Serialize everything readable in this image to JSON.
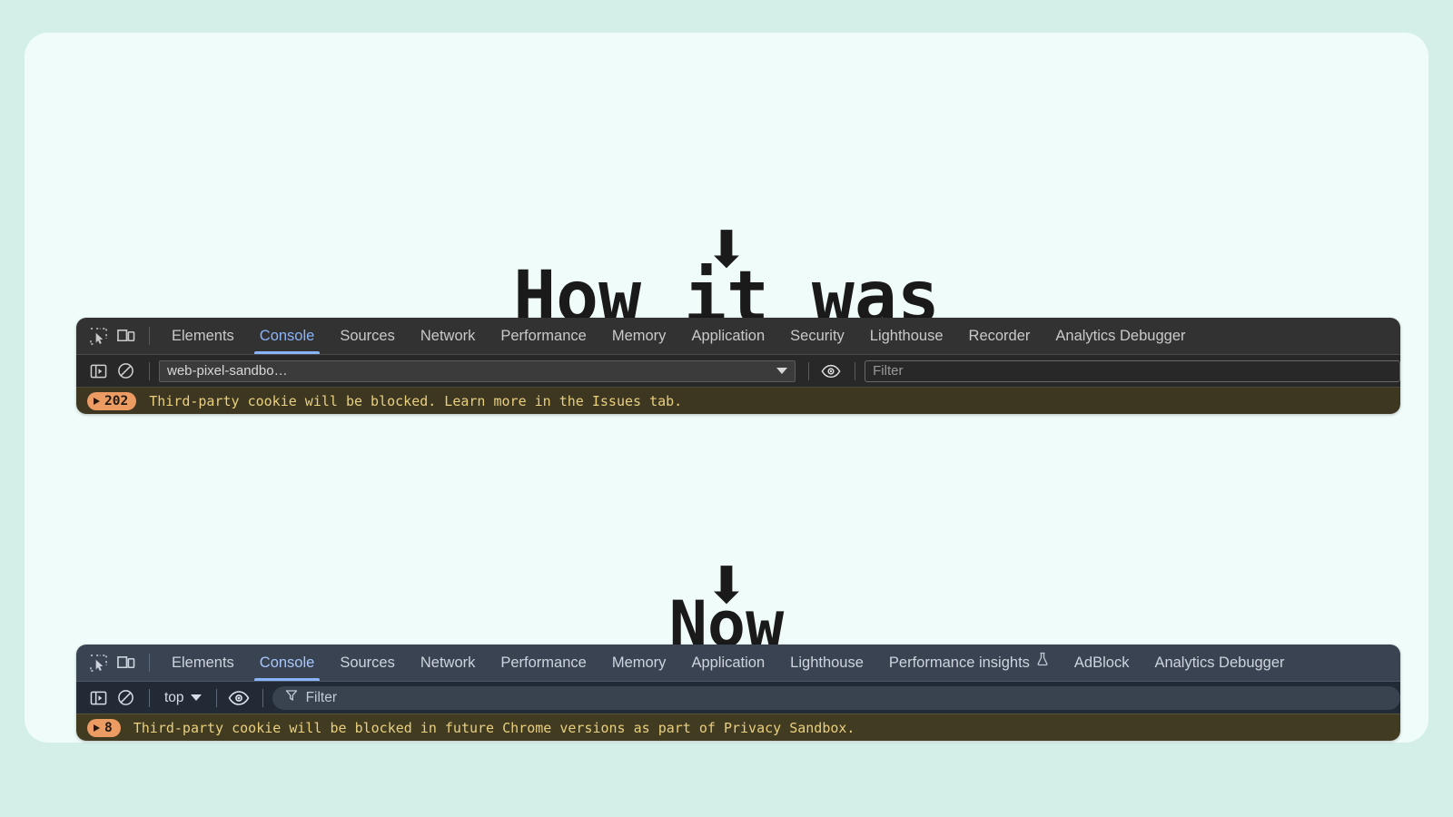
{
  "theme": {
    "page_background": "#d3efe7",
    "card_background": "#effcfa",
    "accent_tab": "#8ab4f8",
    "warning_badge": "#ec9b63",
    "warning_text": "#e9cf7e",
    "warning_row_old": "#3d3721",
    "warning_row_new": "#413b22"
  },
  "sections": {
    "before": {
      "heading": "How it was",
      "arrow": "⬇"
    },
    "after": {
      "heading": "Now",
      "arrow": "⬇"
    }
  },
  "devtools_old": {
    "left_icons": [
      {
        "name": "inspect-element-icon"
      },
      {
        "name": "device-toolbar-icon"
      }
    ],
    "tabs": [
      {
        "label": "Elements",
        "active": false
      },
      {
        "label": "Console",
        "active": true
      },
      {
        "label": "Sources",
        "active": false
      },
      {
        "label": "Network",
        "active": false
      },
      {
        "label": "Performance",
        "active": false
      },
      {
        "label": "Memory",
        "active": false
      },
      {
        "label": "Application",
        "active": false
      },
      {
        "label": "Security",
        "active": false
      },
      {
        "label": "Lighthouse",
        "active": false
      },
      {
        "label": "Recorder",
        "active": false
      },
      {
        "label": "Analytics Debugger",
        "active": false
      }
    ],
    "toolbar": {
      "sidebar_toggle_icon": "sidebar-toggle-icon",
      "clear_console_icon": "clear-console-icon",
      "context_value": "web-pixel-sandbo…",
      "eye_icon": "live-expression-eye-icon",
      "filter_placeholder": "Filter"
    },
    "message": {
      "count": "202",
      "text": "Third-party cookie will be blocked. Learn more in the Issues tab."
    }
  },
  "devtools_new": {
    "left_icons": [
      {
        "name": "inspect-element-icon"
      },
      {
        "name": "device-toolbar-icon"
      }
    ],
    "tabs": [
      {
        "label": "Elements",
        "active": false
      },
      {
        "label": "Console",
        "active": true
      },
      {
        "label": "Sources",
        "active": false
      },
      {
        "label": "Network",
        "active": false
      },
      {
        "label": "Performance",
        "active": false
      },
      {
        "label": "Memory",
        "active": false
      },
      {
        "label": "Application",
        "active": false
      },
      {
        "label": "Lighthouse",
        "active": false
      },
      {
        "label": "Performance insights",
        "active": false,
        "icon": "flask-icon",
        "glyph": "⚗"
      },
      {
        "label": "AdBlock",
        "active": false
      },
      {
        "label": "Analytics Debugger",
        "active": false
      }
    ],
    "toolbar": {
      "sidebar_toggle_icon": "sidebar-toggle-icon",
      "clear_console_icon": "clear-console-icon",
      "context_value": "top",
      "eye_icon": "live-expression-eye-icon",
      "filter_placeholder": "Filter"
    },
    "message": {
      "count": "8",
      "text": "Third-party cookie will be blocked in future Chrome versions as part of Privacy Sandbox."
    }
  }
}
